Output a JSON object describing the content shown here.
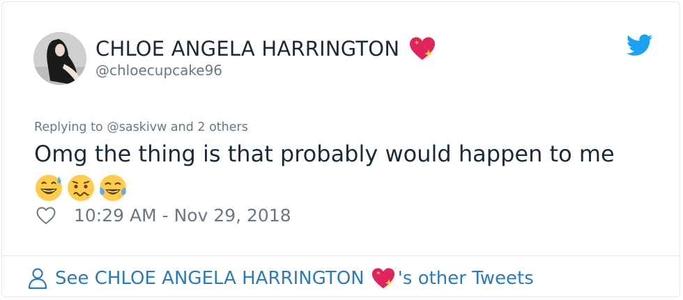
{
  "tweet": {
    "author_name": "CHLOE ANGELA HARRINGTON",
    "author_handle": "@chloecupcake96",
    "replying_to": "Replying to @saskivw and 2 others",
    "text": "Omg the thing is that probably would happen to me",
    "emojis": [
      "grinning-sweat-emoji",
      "woozy-face-emoji",
      "tears-of-joy-emoji"
    ],
    "timestamp": "10:29 AM - Nov 29, 2018"
  },
  "footer": {
    "prefix": "See CHLOE ANGELA HARRINGTON",
    "suffix": "'s other Tweets"
  },
  "icons": {
    "bird": "twitter-bird-icon",
    "heart": "sparkling-heart-icon",
    "like": "like-heart-outline-icon",
    "person": "person-outline-icon"
  },
  "colors": {
    "text": "#1c2938",
    "muted": "#697882",
    "link": "#2b7bb9",
    "twitter_blue": "#1da1f2",
    "heart": "#e0245e",
    "border": "#e1e8ed"
  }
}
